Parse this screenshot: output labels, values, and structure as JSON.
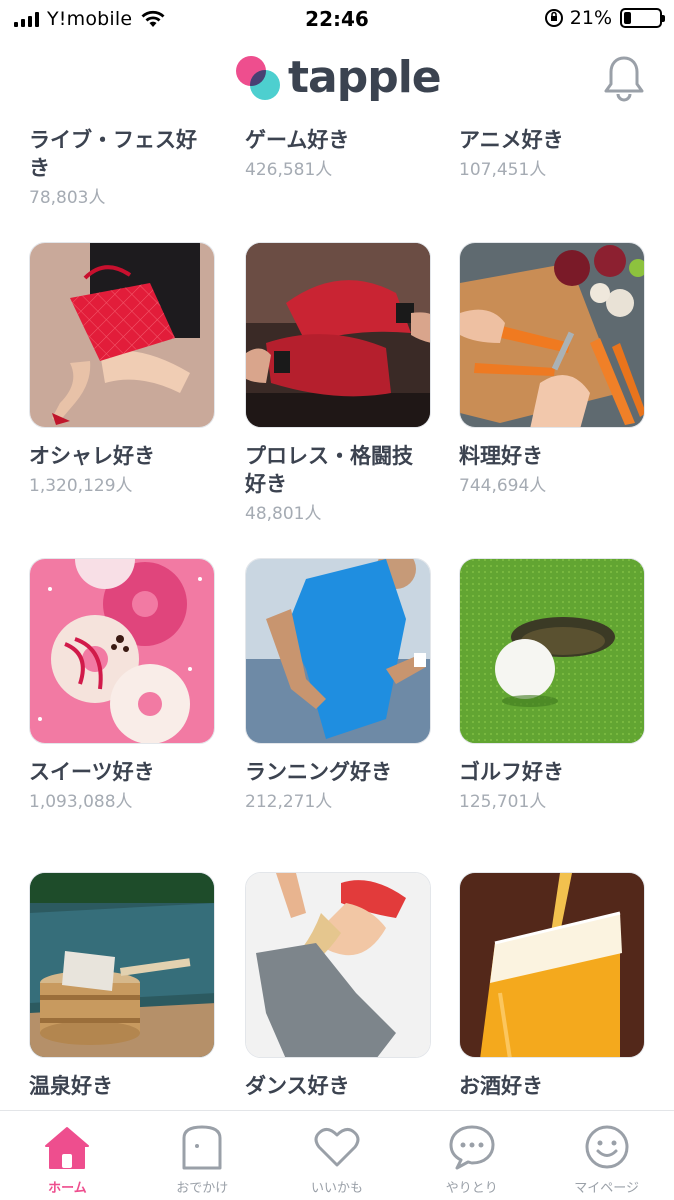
{
  "status_bar": {
    "carrier": "Y!mobile",
    "time": "22:46",
    "battery": "21%",
    "battery_level": 0.21
  },
  "header": {
    "logo_text": "tapple",
    "colors": {
      "pink": "#ee4e8e",
      "teal": "#4dcfcf"
    }
  },
  "communities": [
    {
      "title": "ライブ・フェス好き",
      "count": "78,803人",
      "image": "festival-photo"
    },
    {
      "title": "ゲーム好き",
      "count": "426,581人",
      "image": "game-photo"
    },
    {
      "title": "アニメ好き",
      "count": "107,451人",
      "image": "anime-photo"
    },
    {
      "title": "オシャレ好き",
      "count": "1,320,129人",
      "image": "fashion-handbag-photo"
    },
    {
      "title": "プロレス・格闘技好き",
      "count": "48,801人",
      "image": "boxing-wraps-photo"
    },
    {
      "title": "料理好き",
      "count": "744,694人",
      "image": "cooking-carrots-photo"
    },
    {
      "title": "スイーツ好き",
      "count": "1,093,088人",
      "image": "donuts-photo"
    },
    {
      "title": "ランニング好き",
      "count": "212,271人",
      "image": "runner-photo"
    },
    {
      "title": "ゴルフ好き",
      "count": "125,701人",
      "image": "golf-ball-photo"
    },
    {
      "title": "温泉好き",
      "count": "",
      "image": "hot-spring-bucket-photo"
    },
    {
      "title": "ダンス好き",
      "count": "",
      "image": "dancer-photo"
    },
    {
      "title": "お酒好き",
      "count": "",
      "image": "beer-photo"
    }
  ],
  "bottom_nav": [
    {
      "label": "ホーム",
      "icon": "home-icon",
      "active": true
    },
    {
      "label": "おでかけ",
      "icon": "ghost-icon",
      "active": false
    },
    {
      "label": "いいかも",
      "icon": "heart-icon",
      "active": false
    },
    {
      "label": "やりとり",
      "icon": "chat-bubble-icon",
      "active": false
    },
    {
      "label": "マイページ",
      "icon": "smiley-icon",
      "active": false
    }
  ]
}
